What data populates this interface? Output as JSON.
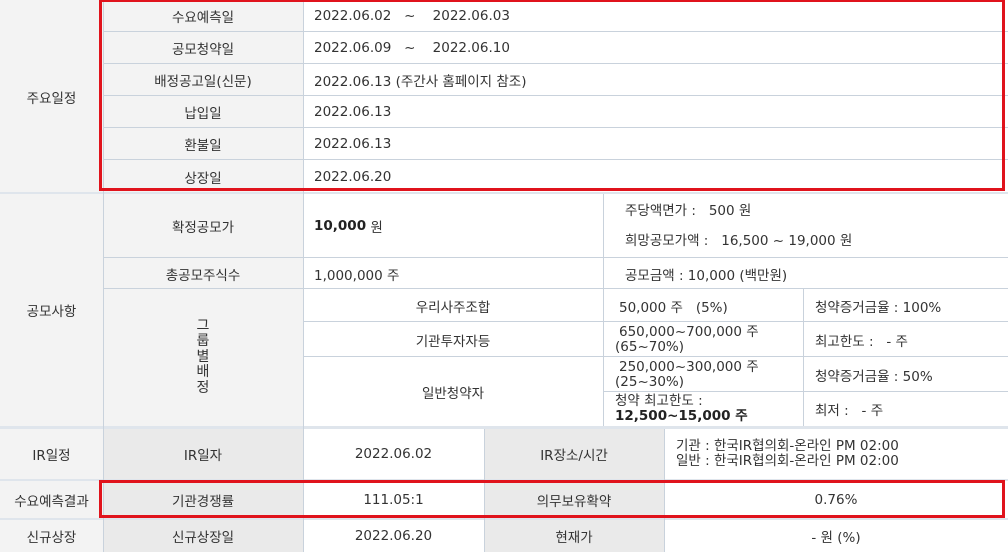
{
  "schedule": {
    "section_label": "주요일정",
    "rows": [
      {
        "label": "수요예측일",
        "value": "2022.06.02   ~    2022.06.03"
      },
      {
        "label": "공모청약일",
        "value": "2022.06.09   ~    2022.06.10"
      },
      {
        "label": "배정공고일(신문)",
        "value": "2022.06.13 (주간사 홈페이지 참조)"
      },
      {
        "label": "납입일",
        "value": "2022.06.13"
      },
      {
        "label": "환불일",
        "value": "2022.06.13"
      },
      {
        "label": "상장일",
        "value": "2022.06.20"
      }
    ]
  },
  "offering": {
    "section_label": "공모사항",
    "final_price_label": "확정공모가",
    "final_price_value": "10,000",
    "final_price_unit": " 원",
    "par_value": "주당액면가 :   500 원",
    "hope_price": "희망공모가액 :   16,500 ~ 19,000 원",
    "total_shares_label": "총공모주식수",
    "total_shares_value": "1,000,000 주",
    "offering_amount": "공모금액 : 10,000 (백만원)",
    "group_label_chars": [
      "그",
      "룹",
      "별",
      "배",
      "정"
    ],
    "groups": [
      {
        "name": "우리사주조합",
        "shares": "50,000 주   (5%)",
        "note": "청약증거금율 : 100%"
      },
      {
        "name": "기관투자자등",
        "shares_line1": "650,000~700,000 주",
        "shares_line2": "(65~70%)",
        "note": "최고한도 :   - 주"
      },
      {
        "name": "일반청약자",
        "shares_line1": "250,000~300,000 주",
        "shares_line2": "(25~30%)",
        "note": "청약증거금율 : 50%",
        "limit_line1": "청약 최고한도 :",
        "limit_line2": "12,500~15,000 주",
        "note2": "최저 :   - 주"
      }
    ]
  },
  "ir": {
    "section_label": "IR일정",
    "date_label": "IR일자",
    "date_value": "2022.06.02",
    "place_label": "IR장소/시간",
    "place_line1": "기관 : 한국IR협의회-온라인 PM 02:00",
    "place_line2": "일반 : 한국IR협의회-온라인 PM 02:00"
  },
  "demand": {
    "section_label": "수요예측결과",
    "competition_label": "기관경쟁률",
    "competition_value": "111.05:1",
    "lockup_label": "의무보유확약",
    "lockup_value": "0.76%"
  },
  "listing": {
    "section_label": "신규상장",
    "date_label": "신규상장일",
    "date_value": "2022.06.20",
    "price_label": "현재가",
    "price_value": "- 원 (%)"
  },
  "colors": {
    "highlight_border": "#e0131c",
    "header_bg": "#f3f3f3",
    "grid_line": "#c9d2dc"
  }
}
